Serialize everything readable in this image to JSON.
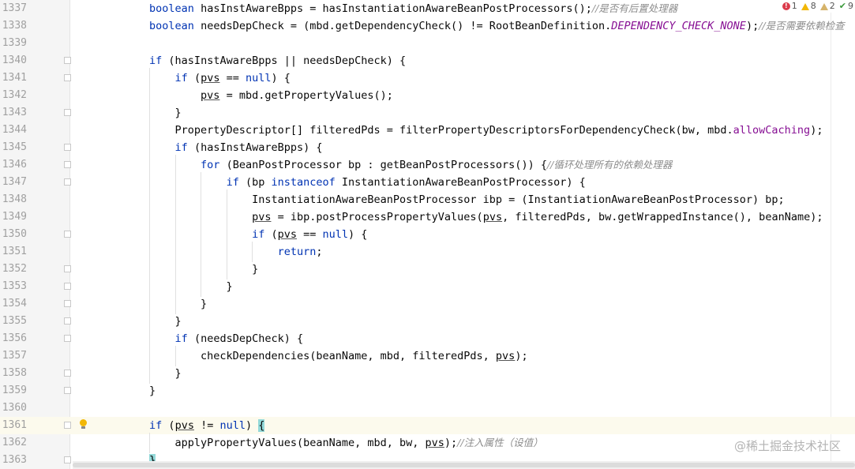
{
  "status": {
    "errors": "1",
    "warnings": "8",
    "weak_warnings": "2",
    "typos": "9"
  },
  "watermark": "@稀土掘金技术社区",
  "current_line": "1361",
  "lines": [
    {
      "num": "1337",
      "fold": false,
      "segments": [
        {
          "t": "        "
        },
        {
          "t": "boolean",
          "c": "kw"
        },
        {
          "t": " hasInstAwareBpps = hasInstantiationAwareBeanPostProcessors();"
        },
        {
          "t": "//是否有后置处理器",
          "c": "cm"
        }
      ]
    },
    {
      "num": "1338",
      "fold": false,
      "segments": [
        {
          "t": "        "
        },
        {
          "t": "boolean",
          "c": "kw"
        },
        {
          "t": " needsDepCheck = (mbd.getDependencyCheck() != RootBeanDefinition."
        },
        {
          "t": "DEPENDENCY_CHECK_NONE",
          "c": "cst"
        },
        {
          "t": ");"
        },
        {
          "t": "//是否需要依赖检查",
          "c": "cm"
        }
      ]
    },
    {
      "num": "1339",
      "fold": false,
      "segments": []
    },
    {
      "num": "1340",
      "fold": true,
      "segments": [
        {
          "t": "        "
        },
        {
          "t": "if",
          "c": "kw"
        },
        {
          "t": " (hasInstAwareBpps || needsDepCheck) {"
        }
      ]
    },
    {
      "num": "1341",
      "fold": true,
      "segments": [
        {
          "t": "            "
        },
        {
          "t": "if",
          "c": "kw"
        },
        {
          "t": " ("
        },
        {
          "t": "pvs",
          "c": "ul"
        },
        {
          "t": " == "
        },
        {
          "t": "null",
          "c": "kw"
        },
        {
          "t": ") {"
        }
      ]
    },
    {
      "num": "1342",
      "fold": false,
      "segments": [
        {
          "t": "                "
        },
        {
          "t": "pvs",
          "c": "ul"
        },
        {
          "t": " = mbd.getPropertyValues();"
        }
      ]
    },
    {
      "num": "1343",
      "fold": true,
      "segments": [
        {
          "t": "            }"
        }
      ]
    },
    {
      "num": "1344",
      "fold": false,
      "segments": [
        {
          "t": "            PropertyDescriptor[] filteredPds = filterPropertyDescriptorsForDependencyCheck(bw, mbd."
        },
        {
          "t": "allowCaching",
          "c": "fld"
        },
        {
          "t": ");"
        }
      ]
    },
    {
      "num": "1345",
      "fold": true,
      "segments": [
        {
          "t": "            "
        },
        {
          "t": "if",
          "c": "kw"
        },
        {
          "t": " (hasInstAwareBpps) {"
        }
      ]
    },
    {
      "num": "1346",
      "fold": true,
      "segments": [
        {
          "t": "                "
        },
        {
          "t": "for",
          "c": "kw"
        },
        {
          "t": " (BeanPostProcessor bp : getBeanPostProcessors()) {"
        },
        {
          "t": "//循环处理所有的依赖处理器",
          "c": "cm"
        }
      ]
    },
    {
      "num": "1347",
      "fold": true,
      "segments": [
        {
          "t": "                    "
        },
        {
          "t": "if",
          "c": "kw"
        },
        {
          "t": " (bp "
        },
        {
          "t": "instanceof",
          "c": "kw"
        },
        {
          "t": " InstantiationAwareBeanPostProcessor) {"
        }
      ]
    },
    {
      "num": "1348",
      "fold": false,
      "segments": [
        {
          "t": "                        InstantiationAwareBeanPostProcessor ibp = (InstantiationAwareBeanPostProcessor) bp;"
        }
      ]
    },
    {
      "num": "1349",
      "fold": false,
      "segments": [
        {
          "t": "                        "
        },
        {
          "t": "pvs",
          "c": "ul"
        },
        {
          "t": " = ibp.postProcessPropertyValues("
        },
        {
          "t": "pvs",
          "c": "ul"
        },
        {
          "t": ", filteredPds, bw.getWrappedInstance(), beanName);"
        }
      ]
    },
    {
      "num": "1350",
      "fold": true,
      "segments": [
        {
          "t": "                        "
        },
        {
          "t": "if",
          "c": "kw"
        },
        {
          "t": " ("
        },
        {
          "t": "pvs",
          "c": "ul"
        },
        {
          "t": " == "
        },
        {
          "t": "null",
          "c": "kw"
        },
        {
          "t": ") {"
        }
      ]
    },
    {
      "num": "1351",
      "fold": false,
      "segments": [
        {
          "t": "                            "
        },
        {
          "t": "return",
          "c": "kw"
        },
        {
          "t": ";"
        }
      ]
    },
    {
      "num": "1352",
      "fold": true,
      "segments": [
        {
          "t": "                        }"
        }
      ]
    },
    {
      "num": "1353",
      "fold": true,
      "segments": [
        {
          "t": "                    }"
        }
      ]
    },
    {
      "num": "1354",
      "fold": true,
      "segments": [
        {
          "t": "                }"
        }
      ]
    },
    {
      "num": "1355",
      "fold": true,
      "segments": [
        {
          "t": "            }"
        }
      ]
    },
    {
      "num": "1356",
      "fold": true,
      "segments": [
        {
          "t": "            "
        },
        {
          "t": "if",
          "c": "kw"
        },
        {
          "t": " (needsDepCheck) {"
        }
      ]
    },
    {
      "num": "1357",
      "fold": false,
      "segments": [
        {
          "t": "                checkDependencies(beanName, mbd, filteredPds, "
        },
        {
          "t": "pvs",
          "c": "ul"
        },
        {
          "t": ");"
        }
      ]
    },
    {
      "num": "1358",
      "fold": true,
      "segments": [
        {
          "t": "            }"
        }
      ]
    },
    {
      "num": "1359",
      "fold": true,
      "segments": [
        {
          "t": "        }"
        }
      ]
    },
    {
      "num": "1360",
      "fold": false,
      "segments": []
    },
    {
      "num": "1361",
      "fold": true,
      "bulb": true,
      "segments": [
        {
          "t": "        "
        },
        {
          "t": "if",
          "c": "kw"
        },
        {
          "t": " ("
        },
        {
          "t": "pvs",
          "c": "ul"
        },
        {
          "t": " != "
        },
        {
          "t": "null",
          "c": "kw"
        },
        {
          "t": ") "
        },
        {
          "t": "{",
          "c": "brace"
        }
      ]
    },
    {
      "num": "1362",
      "fold": false,
      "segments": [
        {
          "t": "            applyPropertyValues(beanName, mbd, bw, "
        },
        {
          "t": "pvs",
          "c": "ul"
        },
        {
          "t": ");"
        },
        {
          "t": "//注入属性（设值）",
          "c": "cm"
        }
      ]
    },
    {
      "num": "1363",
      "fold": true,
      "segments": [
        {
          "t": "        "
        },
        {
          "t": "}",
          "c": "brace"
        }
      ]
    }
  ]
}
